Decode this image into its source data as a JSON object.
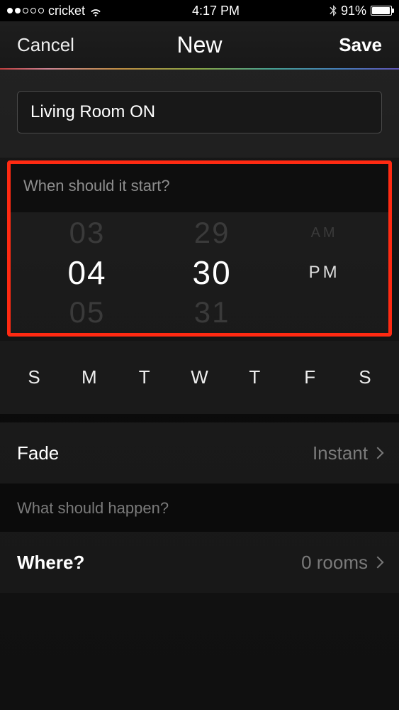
{
  "status": {
    "carrier": "cricket",
    "time": "4:17 PM",
    "battery_pct": "91%",
    "battery_fill_pct": 91
  },
  "nav": {
    "cancel": "Cancel",
    "title": "New",
    "save": "Save"
  },
  "form": {
    "name_value": "Living Room ON"
  },
  "time_section": {
    "header": "When should it start?",
    "hour_prev": "03",
    "hour_sel": "04",
    "hour_next": "05",
    "min_prev": "29",
    "min_sel": "30",
    "min_next": "31",
    "ampm_prev": "AM",
    "ampm_sel": "PM"
  },
  "days": {
    "d0": "S",
    "d1": "M",
    "d2": "T",
    "d3": "W",
    "d4": "T",
    "d5": "F",
    "d6": "S"
  },
  "fade_row": {
    "label": "Fade",
    "value": "Instant"
  },
  "happen_section": {
    "header": "What should happen?"
  },
  "where_row": {
    "label": "Where?",
    "value": "0 rooms"
  }
}
